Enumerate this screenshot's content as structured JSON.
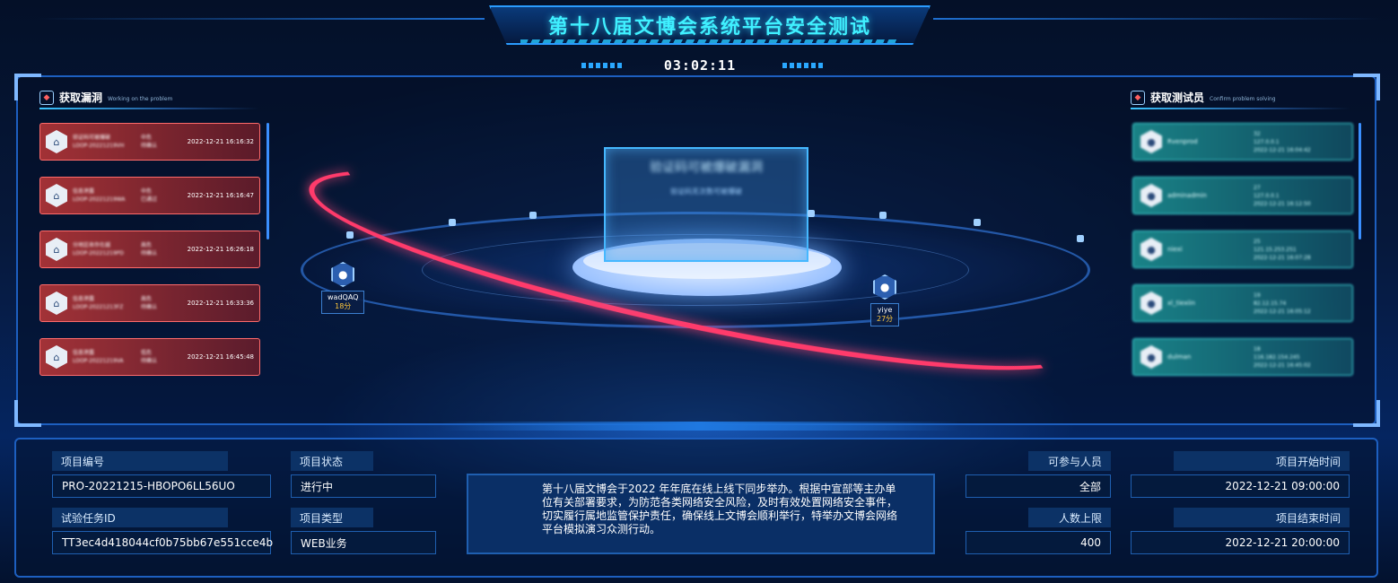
{
  "header": {
    "title": "第十八届文博会系统平台安全测试",
    "timer": "03:02:11"
  },
  "left_panel": {
    "title": "获取漏洞",
    "subtitle": "Working on the problem",
    "items": [
      {
        "name": "验证码可被爆破",
        "id": "LOOP-20221219VH",
        "level": "中危",
        "status": "待确认",
        "time": "2022-12-21 16:16:32"
      },
      {
        "name": "信息泄露",
        "id": "LOOP-20221219WA",
        "level": "中危",
        "status": "已通过",
        "time": "2022-12-21 16:16:47"
      },
      {
        "name": "分地区收存在越",
        "id": "LOOP-20221219PD",
        "level": "高危",
        "status": "待确认",
        "time": "2022-12-21 16:26:18"
      },
      {
        "name": "信息泄露",
        "id": "LOOP-20221213FZ",
        "level": "高危",
        "status": "待确认",
        "time": "2022-12-21 16:33:36"
      },
      {
        "name": "信息泄露",
        "id": "LOOP-20221219VA",
        "level": "低危",
        "status": "待确认",
        "time": "2022-12-21 16:45:48"
      }
    ]
  },
  "right_panel": {
    "title": "获取测试员",
    "subtitle": "Confirm problem solving",
    "items": [
      {
        "name": "Rvenprod",
        "score": "32",
        "ip": "127.0.0.1",
        "time": "2022-12-21 16:04:42"
      },
      {
        "name": "adminadmin",
        "score": "27",
        "ip": "127.0.0.1",
        "time": "2022-12-21 16:12:50"
      },
      {
        "name": "niexi",
        "score": "25",
        "ip": "121.15.253.251",
        "time": "2022-12-21 16:07:28"
      },
      {
        "name": "xl_tiexiin",
        "score": "19",
        "ip": "82.12.15.74",
        "time": "2022-12-21 16:05:12"
      },
      {
        "name": "dulman",
        "score": "18",
        "ip": "116.182.154.245",
        "time": "2022-12-21 16:45:02"
      }
    ]
  },
  "center": {
    "holo_title": "验证码可被爆破漏洞",
    "holo_sub": "验证码无次数可被爆破",
    "avatars": [
      {
        "name": "wadQAQ",
        "score": "18分"
      },
      {
        "name": "yiye",
        "score": "27分"
      }
    ]
  },
  "info": {
    "project_no_label": "项目编号",
    "project_no": "PRO-20221215-HBOPO6LL56UO",
    "task_id_label": "试验任务ID",
    "task_id": "TT3ec4d418044cf0b75bb67e551cce4b",
    "status_label": "项目状态",
    "status": "进行中",
    "type_label": "项目类型",
    "type": "WEB业务",
    "description": "第十八届文博会于2022 年年底在线上线下同步举办。根据中宣部等主办单位有关部署要求，为防范各类网络安全风险，及时有效处置网络安全事件，切实履行属地监管保护责任，确保线上文博会顺利举行，特举办文博会网络平台模拟演习众测行动。",
    "participants_label": "可参与人员",
    "participants": "全部",
    "limit_label": "人数上限",
    "limit": "400",
    "start_label": "项目开始时间",
    "start": "2022-12-21 09:00:00",
    "end_label": "项目结束时间",
    "end": "2022-12-21 20:00:00"
  },
  "colors": {
    "accent": "#3ff0ff",
    "vuln_card": "#b83a3a",
    "tester_card": "#1e9696",
    "score": "#ffc83a"
  }
}
